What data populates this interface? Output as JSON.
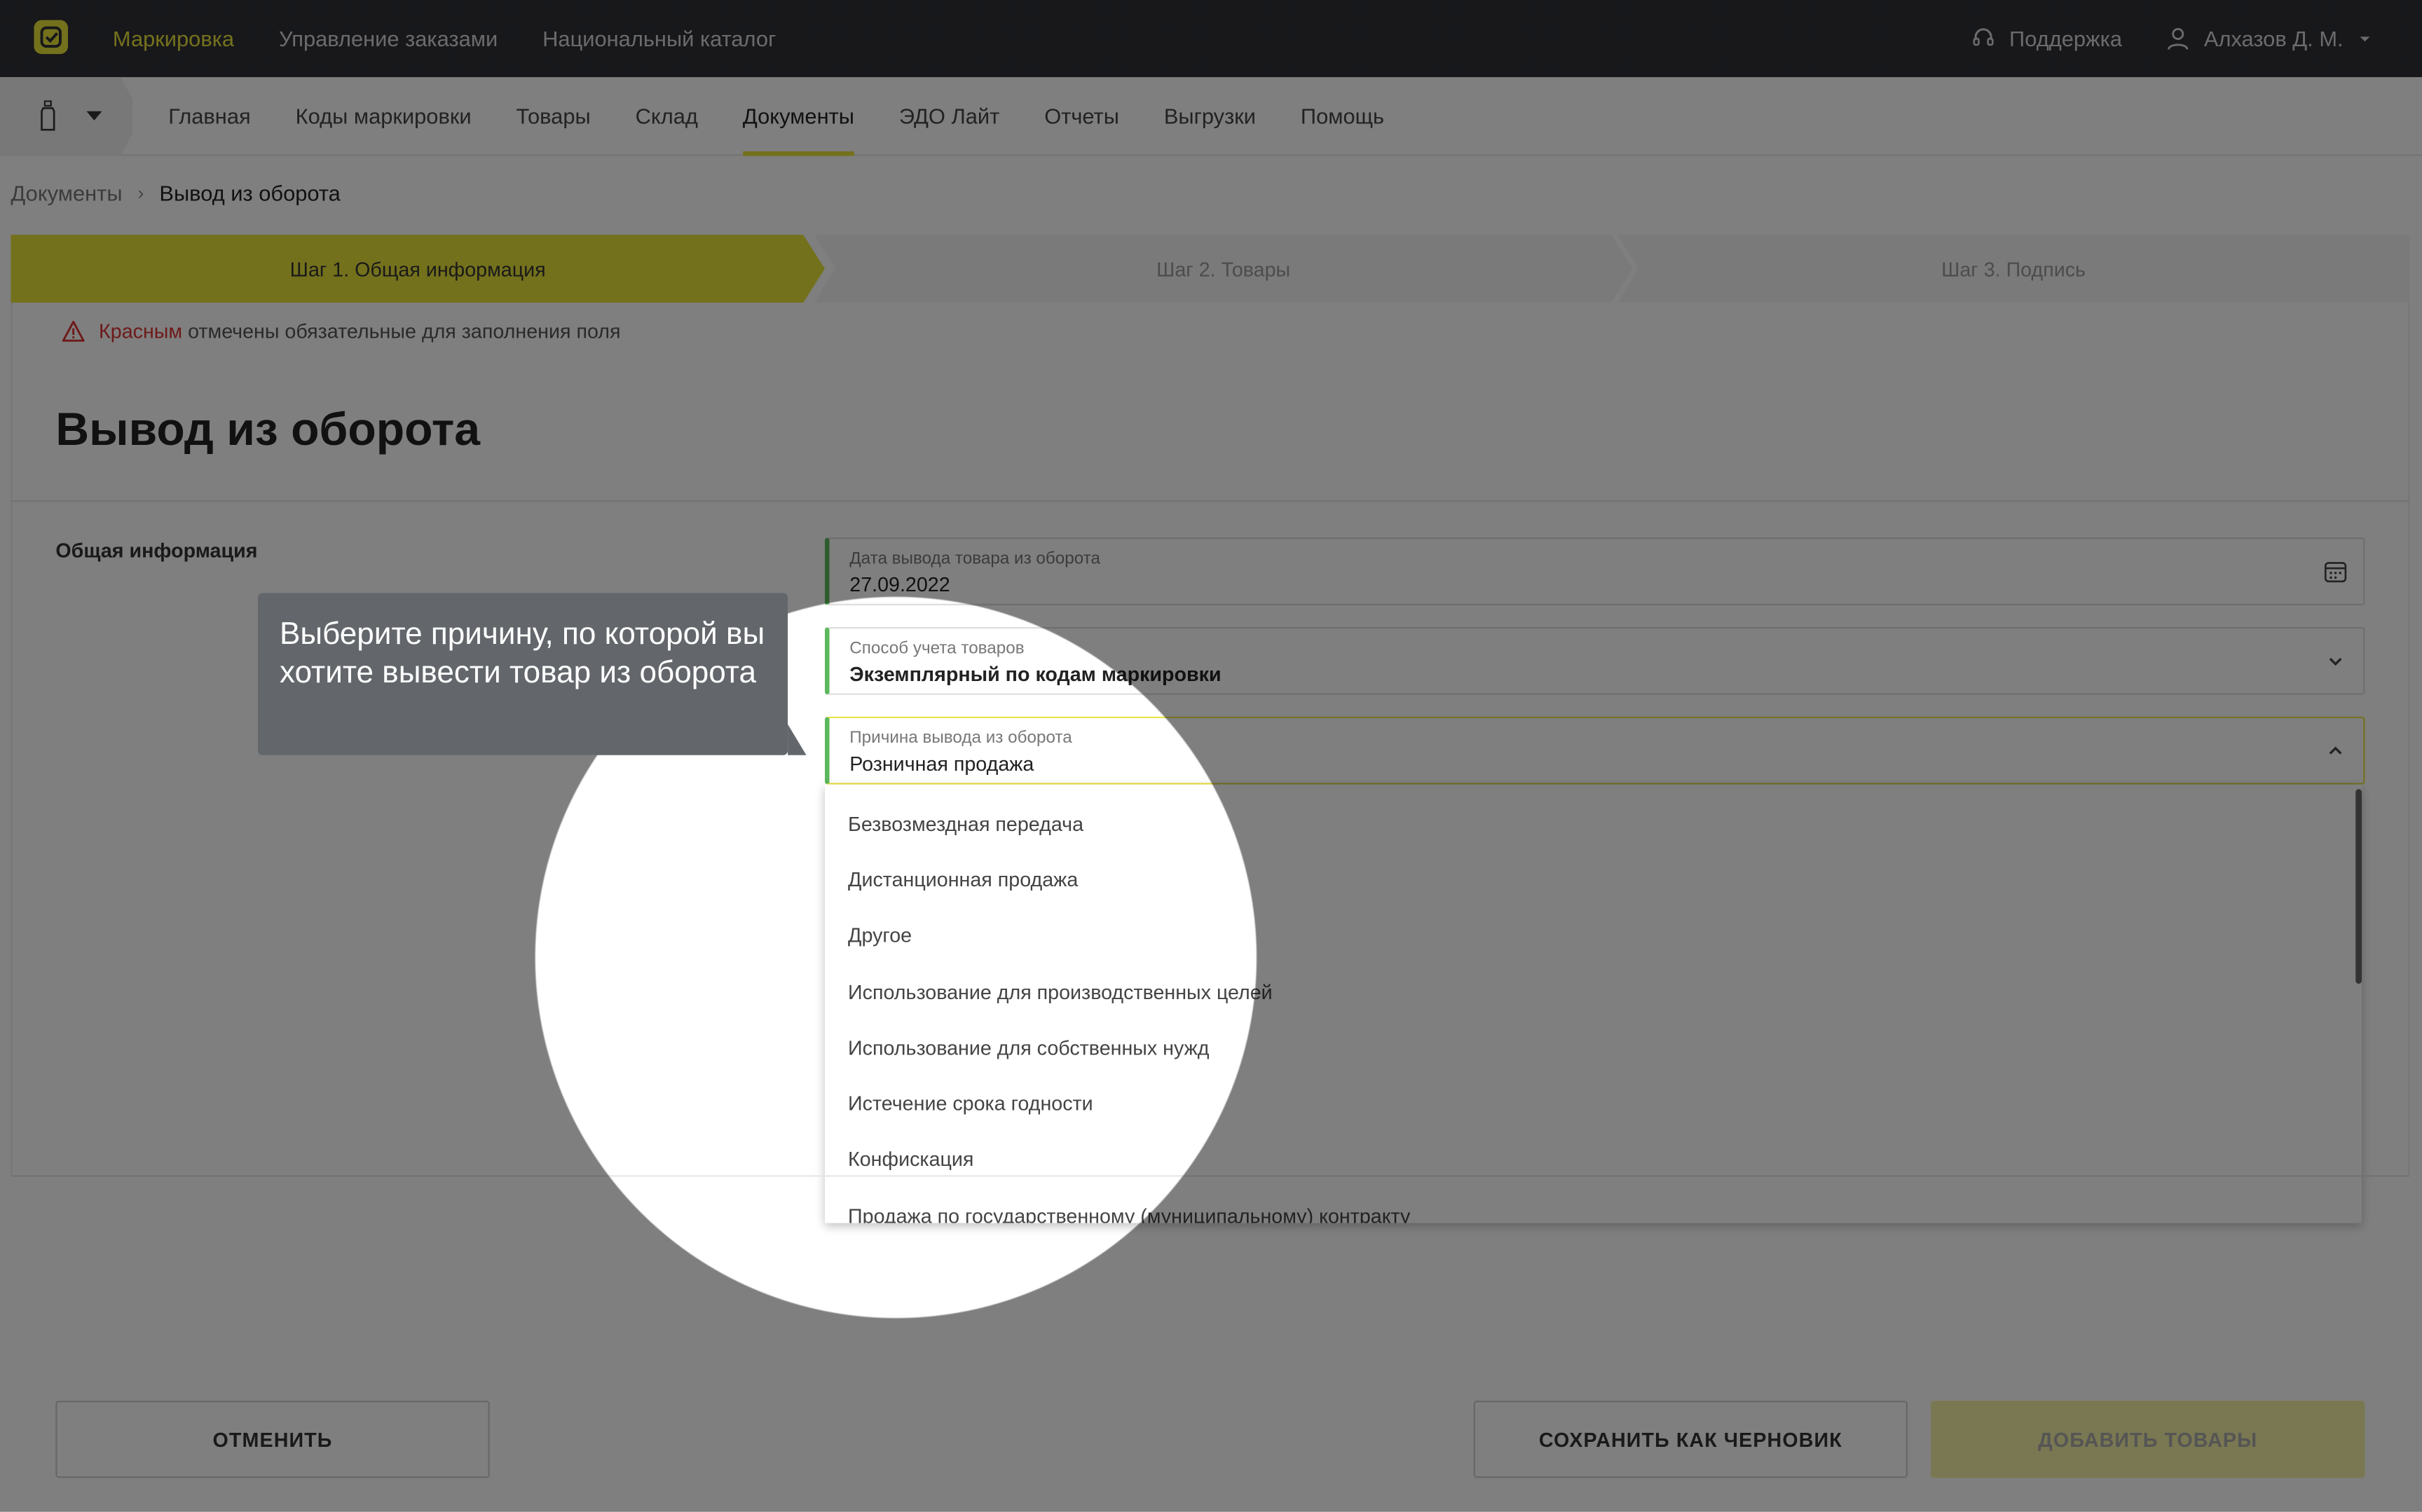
{
  "topbar": {
    "nav": [
      "Маркировка",
      "Управление заказами",
      "Национальный каталог"
    ],
    "support": "Поддержка",
    "user": "Алхазов Д. М."
  },
  "subnav": {
    "items": [
      "Главная",
      "Коды маркировки",
      "Товары",
      "Склад",
      "Документы",
      "ЭДО Лайт",
      "Отчеты",
      "Выгрузки",
      "Помощь"
    ],
    "active": "Документы"
  },
  "breadcrumb": {
    "parent": "Документы",
    "current": "Вывод из оборота"
  },
  "steps": [
    "Шаг 1. Общая информация",
    "Шаг 2. Товары",
    "Шаг 3. Подпись"
  ],
  "required_note": {
    "red": "Красным",
    "rest": "отмечены обязательные для заполнения поля"
  },
  "page_title": "Вывод из оборота",
  "section_label": "Общая информация",
  "fields": {
    "date": {
      "label": "Дата вывода товара из оборота",
      "value": "27.09.2022"
    },
    "method": {
      "label": "Способ учета товаров",
      "value": "Экземплярный по кодам маркировки"
    },
    "reason": {
      "label": "Причина вывода из оборота",
      "value": "Розничная продажа"
    }
  },
  "dropdown_options": [
    "Безвозмездная передача",
    "Дистанционная продажа",
    "Другое",
    "Использование для производственных целей",
    "Использование для собственных нужд",
    "Истечение срока годности",
    "Конфискация",
    "Продажа по государственному (муниципальному) контракту"
  ],
  "buttons": {
    "cancel": "ОТМЕНИТЬ",
    "draft": "СОХРАНИТЬ КАК ЧЕРНОВИК",
    "add": "ДОБАВИТЬ ТОВАРЫ"
  },
  "tooltip": "Выберите причину, по которой вы хотите вывести товар из оборота",
  "colors": {
    "accent": "#e8e33a",
    "topbar": "#2f3136",
    "valid": "#5cb85c",
    "required": "#dd3333"
  }
}
